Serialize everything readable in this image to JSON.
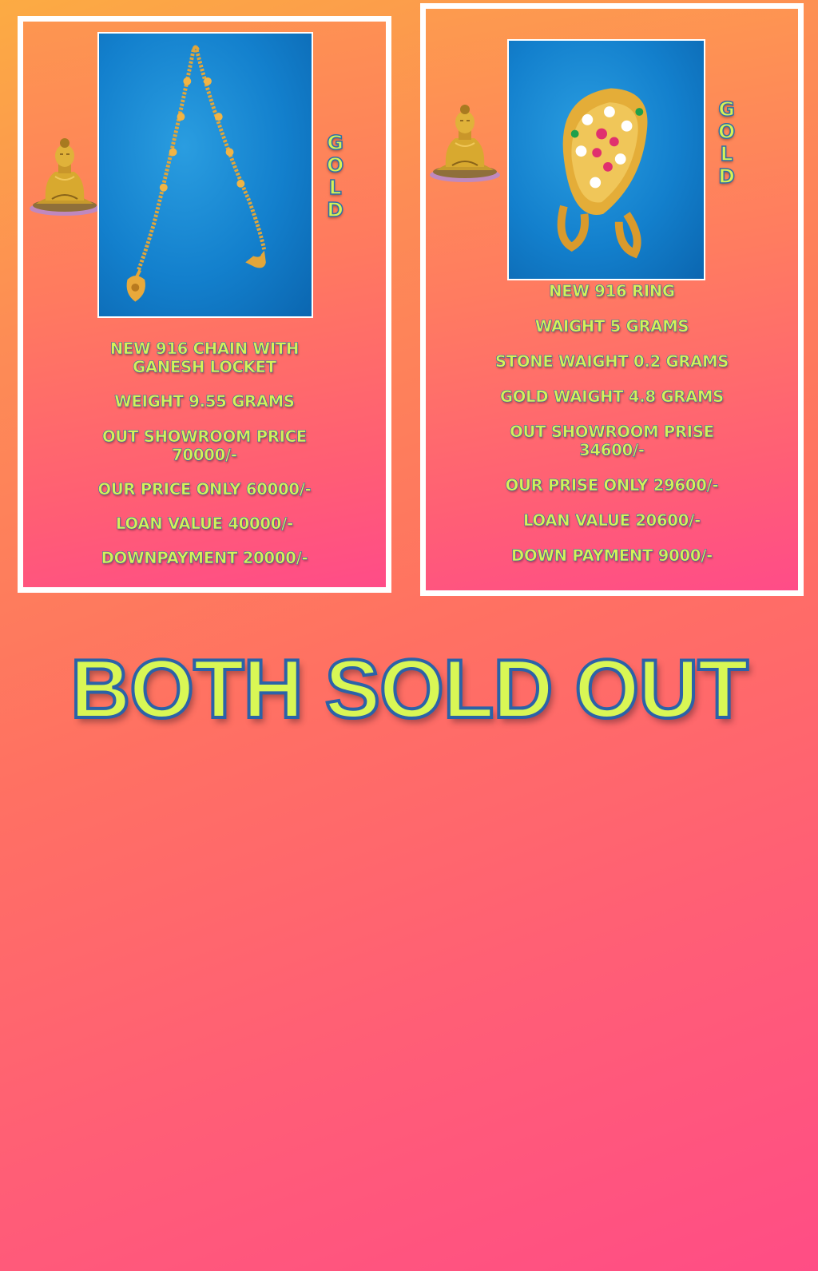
{
  "colors": {
    "text_accent": "#d6f256",
    "text_outline": "#2c6fa8",
    "card_border": "#ffffff",
    "photo_background": "#1380cd"
  },
  "cards": [
    {
      "gold_label": "GOLD",
      "photo_icon": "gold-chain-with-ganesh-locket",
      "decor_icon": "buddha-statue",
      "lines": [
        "NEW 916 CHAIN WITH",
        "GANESH LOCKET",
        "WEIGHT 9.55 GRAMS",
        "OUT SHOWROOM PRICE",
        "70000/-",
        "OUR PRICE ONLY 60000/-",
        "LOAN VALUE  40000/-",
        "DOWNPAYMENT 20000/-"
      ]
    },
    {
      "gold_label": "GOLD",
      "photo_icon": "gold-stone-ring",
      "decor_icon": "buddha-statue",
      "lines": [
        "NEW 916  RING",
        "WAIGHT 5 GRAMS",
        "STONE WAIGHT 0.2 GRAMS",
        "GOLD WAIGHT 4.8 GRAMS",
        "OUT SHOWROOM PRISE",
        "34600/-",
        "OUR PRISE ONLY  29600/-",
        "LOAN VALUE 20600/-",
        "DOWN PAYMENT 9000/-"
      ]
    }
  ],
  "banner": "BOTH SOLD OUT"
}
